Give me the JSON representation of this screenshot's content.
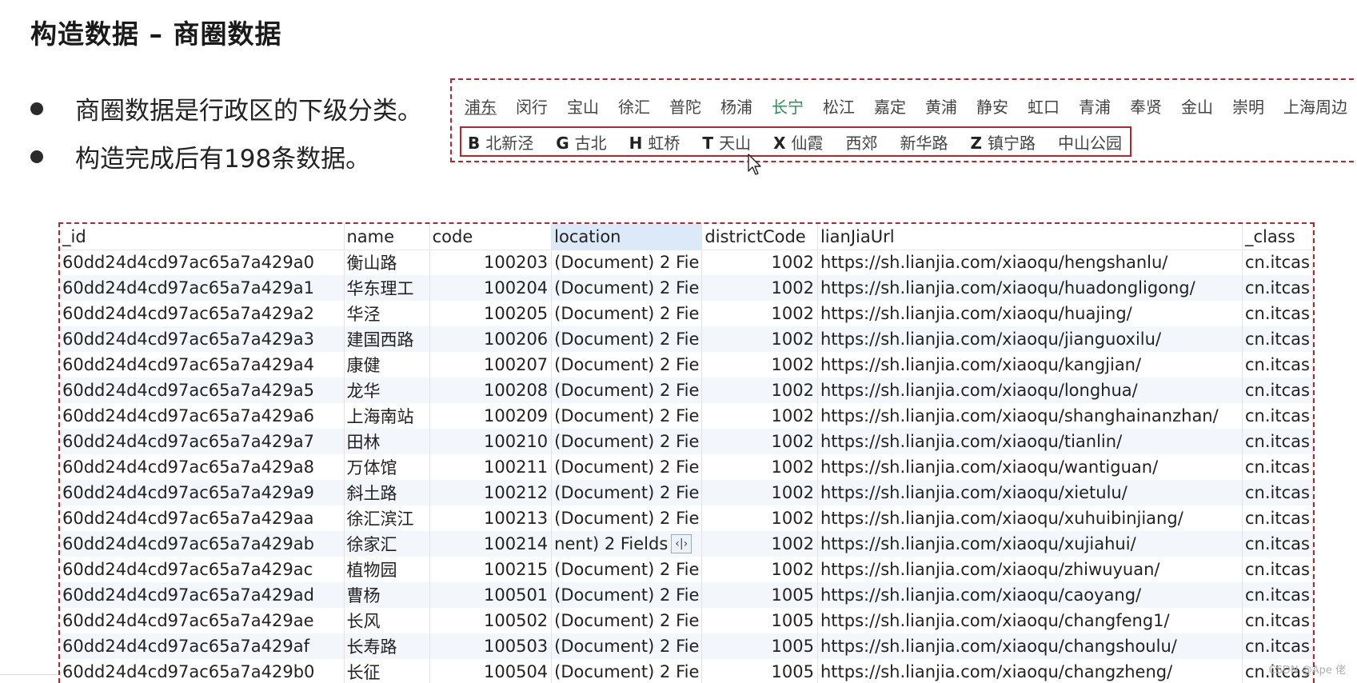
{
  "slide": {
    "title": "构造数据 – 商圈数据",
    "bullets": [
      "商圈数据是行政区的下级分类。",
      "构造完成后有198条数据。"
    ]
  },
  "districts": [
    "浦东",
    "闵行",
    "宝山",
    "徐汇",
    "普陀",
    "杨浦",
    "长宁",
    "松江",
    "嘉定",
    "黄浦",
    "静安",
    "虹口",
    "青浦",
    "奉贤",
    "金山",
    "崇明",
    "上海周边"
  ],
  "active_district": "长宁",
  "sub_areas": [
    {
      "letter": "B",
      "name": "北新泾"
    },
    {
      "letter": "G",
      "name": "古北"
    },
    {
      "letter": "H",
      "name": "虹桥"
    },
    {
      "letter": "T",
      "name": "天山"
    },
    {
      "letter": "X",
      "name": "仙霞"
    },
    {
      "letter": "",
      "name": "西郊"
    },
    {
      "letter": "",
      "name": "新华路"
    },
    {
      "letter": "Z",
      "name": "镇宁路"
    },
    {
      "letter": "",
      "name": "中山公园"
    }
  ],
  "table": {
    "columns": [
      "_id",
      "name",
      "code",
      "location",
      "districtCode",
      "lianJiaUrl",
      "_class"
    ],
    "location_value": "(Document) 2 Fie",
    "editing_value": "nent) 2 Fields",
    "edit_button_label": "‹|›",
    "class_value": "cn.itcas",
    "rows": [
      [
        "60dd24d4cd97ac65a7a429a0",
        "衡山路",
        "100203",
        "1002",
        "https://sh.lianjia.com/xiaoqu/hengshanlu/"
      ],
      [
        "60dd24d4cd97ac65a7a429a1",
        "华东理工",
        "100204",
        "1002",
        "https://sh.lianjia.com/xiaoqu/huadongligong/"
      ],
      [
        "60dd24d4cd97ac65a7a429a2",
        "华泾",
        "100205",
        "1002",
        "https://sh.lianjia.com/xiaoqu/huajing/"
      ],
      [
        "60dd24d4cd97ac65a7a429a3",
        "建国西路",
        "100206",
        "1002",
        "https://sh.lianjia.com/xiaoqu/jianguoxilu/"
      ],
      [
        "60dd24d4cd97ac65a7a429a4",
        "康健",
        "100207",
        "1002",
        "https://sh.lianjia.com/xiaoqu/kangjian/"
      ],
      [
        "60dd24d4cd97ac65a7a429a5",
        "龙华",
        "100208",
        "1002",
        "https://sh.lianjia.com/xiaoqu/longhua/"
      ],
      [
        "60dd24d4cd97ac65a7a429a6",
        "上海南站",
        "100209",
        "1002",
        "https://sh.lianjia.com/xiaoqu/shanghainanzhan/"
      ],
      [
        "60dd24d4cd97ac65a7a429a7",
        "田林",
        "100210",
        "1002",
        "https://sh.lianjia.com/xiaoqu/tianlin/"
      ],
      [
        "60dd24d4cd97ac65a7a429a8",
        "万体馆",
        "100211",
        "1002",
        "https://sh.lianjia.com/xiaoqu/wantiguan/"
      ],
      [
        "60dd24d4cd97ac65a7a429a9",
        "斜土路",
        "100212",
        "1002",
        "https://sh.lianjia.com/xiaoqu/xietulu/"
      ],
      [
        "60dd24d4cd97ac65a7a429aa",
        "徐汇滨江",
        "100213",
        "1002",
        "https://sh.lianjia.com/xiaoqu/xuhuibinjiang/"
      ],
      [
        "60dd24d4cd97ac65a7a429ab",
        "徐家汇",
        "100214",
        "1002",
        "https://sh.lianjia.com/xiaoqu/xujiahui/"
      ],
      [
        "60dd24d4cd97ac65a7a429ac",
        "植物园",
        "100215",
        "1002",
        "https://sh.lianjia.com/xiaoqu/zhiwuyuan/"
      ],
      [
        "60dd24d4cd97ac65a7a429ad",
        "曹杨",
        "100501",
        "1005",
        "https://sh.lianjia.com/xiaoqu/caoyang/"
      ],
      [
        "60dd24d4cd97ac65a7a429ae",
        "长风",
        "100502",
        "1005",
        "https://sh.lianjia.com/xiaoqu/changfeng1/"
      ],
      [
        "60dd24d4cd97ac65a7a429af",
        "长寿路",
        "100503",
        "1005",
        "https://sh.lianjia.com/xiaoqu/changshoulu/"
      ],
      [
        "60dd24d4cd97ac65a7a429b0",
        "长征",
        "100504",
        "1005",
        "https://sh.lianjia.com/xiaoqu/changzheng/"
      ]
    ],
    "editing_row": 11
  },
  "watermark": "CSDN @Ape 佬",
  "colors": {
    "highlight_box": "#b3262c",
    "active_district": "#2e8b57",
    "header_highlight": "#dce9f8"
  },
  "icons": {
    "cursor": "arrow-cursor-icon"
  }
}
